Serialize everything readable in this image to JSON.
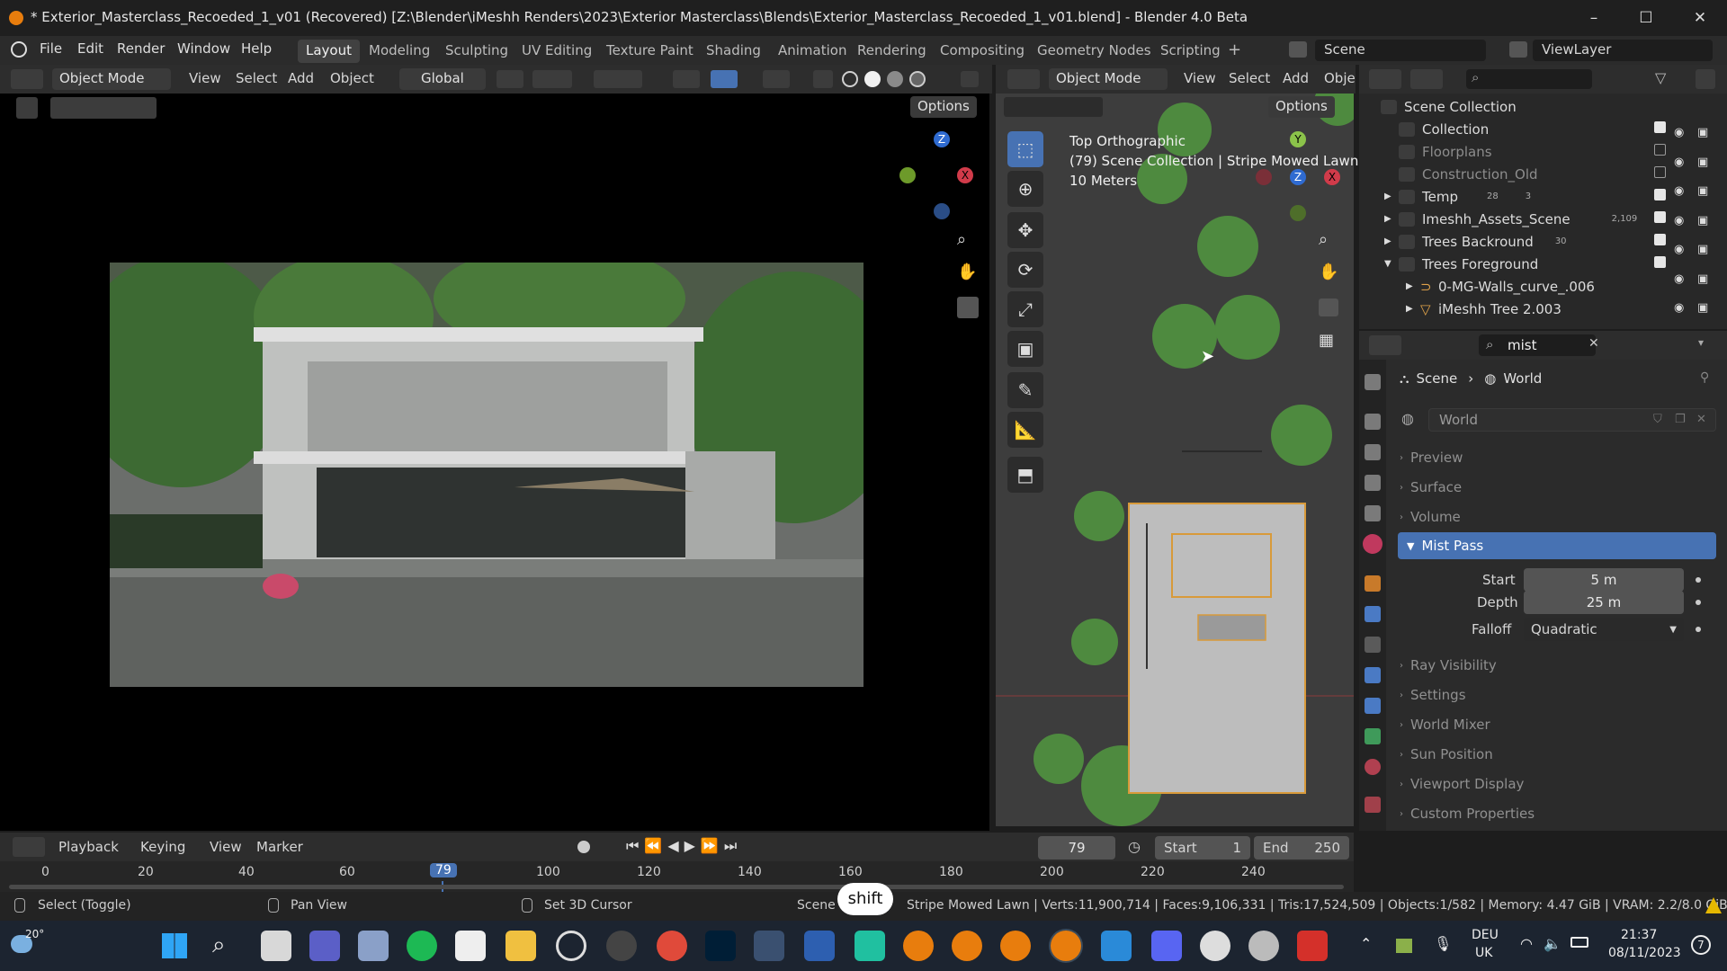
{
  "window": {
    "title": "* Exterior_Masterclass_Recoeded_1_v01 (Recovered) [Z:\\Blender\\iMeshh Renders\\2023\\Exterior Masterclass\\Blends\\Exterior_Masterclass_Recoeded_1_v01.blend] - Blender 4.0 Beta"
  },
  "menu": [
    "File",
    "Edit",
    "Render",
    "Window",
    "Help"
  ],
  "workspaces": [
    "Layout",
    "Modeling",
    "Sculpting",
    "UV Editing",
    "Texture Paint",
    "Shading",
    "Animation",
    "Rendering",
    "Compositing",
    "Geometry Nodes",
    "Scripting"
  ],
  "scene_selector": {
    "scene": "Scene",
    "view_layer": "ViewLayer"
  },
  "left_header": {
    "mode": "Object Mode",
    "view": "View",
    "select": "Select",
    "add": "Add",
    "object": "Object",
    "orientation": "Global",
    "options": "Options"
  },
  "right_header": {
    "mode": "Object Mode",
    "view": "View",
    "select": "Select",
    "add": "Add",
    "object": "Obje",
    "options": "Options"
  },
  "viewport_info": {
    "line1": "Top Orthographic",
    "line2": "(79) Scene Collection | Stripe Mowed Lawn",
    "line3": "10 Meters"
  },
  "outliner": {
    "root": "Scene Collection",
    "items": [
      {
        "label": "Collection"
      },
      {
        "label": "Floorplans"
      },
      {
        "label": "Construction_Old"
      },
      {
        "label": "Temp"
      },
      {
        "label": "Imeshh_Assets_Scene"
      },
      {
        "label": "Trees Backround"
      },
      {
        "label": "Trees Foreground"
      },
      {
        "label": "0-MG-Walls_curve_.006"
      },
      {
        "label": "iMeshh Tree 2.003"
      }
    ],
    "badges": {
      "temp1": "28",
      "temp2": "3",
      "assets": "2,109",
      "trees": "30"
    }
  },
  "properties": {
    "search": "mist",
    "breadcrumb": {
      "scene": "Scene",
      "world": "World"
    },
    "datablock": "World",
    "sections_top": [
      "Preview",
      "Surface",
      "Volume"
    ],
    "mist": {
      "title": "Mist Pass",
      "start_label": "Start",
      "start": "5 m",
      "depth_label": "Depth",
      "depth": "25 m",
      "falloff_label": "Falloff",
      "falloff": "Quadratic"
    },
    "sections_bottom": [
      "Ray Visibility",
      "Settings",
      "World Mixer",
      "Sun Position",
      "Viewport Display",
      "Custom Properties"
    ]
  },
  "timeline": {
    "menus": [
      "Playback",
      "Keying",
      "View",
      "Marker"
    ],
    "current_frame": "79",
    "start_label": "Start",
    "start": "1",
    "end_label": "End",
    "end": "250",
    "ticks": [
      "0",
      "20",
      "40",
      "60",
      "79",
      "100",
      "120",
      "140",
      "160",
      "180",
      "200",
      "220",
      "240"
    ]
  },
  "statusbar": {
    "select": "Select (Toggle)",
    "pan": "Pan View",
    "cursor": "Set 3D Cursor",
    "scene": "Scene",
    "key_overlay": "shift",
    "stats": "Stripe Mowed Lawn | Verts:11,900,714 | Faces:9,106,331 | Tris:17,524,509 | Objects:1/582 | Memory: 4.47 GiB | VRAM: 2.2/8.0 GiB"
  },
  "taskbar": {
    "temp": "20°",
    "lang1": "DEU",
    "lang2": "UK",
    "time": "21:37",
    "date": "08/11/2023",
    "notif": "7"
  }
}
